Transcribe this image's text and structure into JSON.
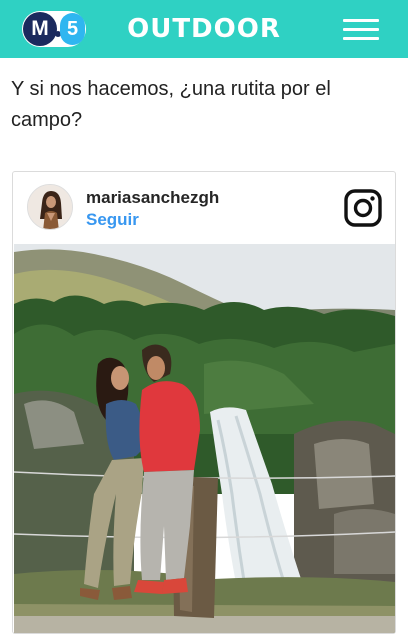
{
  "header": {
    "logo_letter": "M",
    "logo_number": "5",
    "brand": "OUTDOOR",
    "background": "#2fd1c3"
  },
  "article": {
    "headline": "Y si nos hacemos, ¿una rutita por el campo?"
  },
  "embed": {
    "username": "mariasanchezgh",
    "follow_label": "Seguir",
    "follow_color": "#3897f0",
    "icon": "instagram-icon",
    "photo_description_icon": "photo"
  }
}
